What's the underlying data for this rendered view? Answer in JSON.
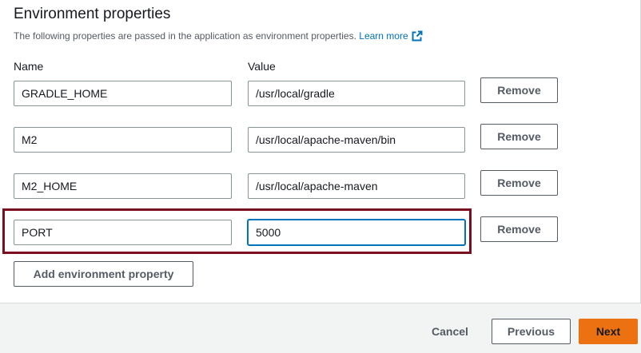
{
  "section": {
    "title": "Environment properties",
    "description": "The following properties are passed in the application as environment properties.",
    "learn_more": "Learn more",
    "name_label": "Name",
    "value_label": "Value"
  },
  "properties": [
    {
      "name": "GRADLE_HOME",
      "value": "/usr/local/gradle",
      "remove_label": "Remove"
    },
    {
      "name": "M2",
      "value": "/usr/local/apache-maven/bin",
      "remove_label": "Remove"
    },
    {
      "name": "M2_HOME",
      "value": "/usr/local/apache-maven",
      "remove_label": "Remove"
    },
    {
      "name": "PORT",
      "value": "5000",
      "remove_label": "Remove"
    }
  ],
  "add_button": "Add environment property",
  "footer": {
    "cancel": "Cancel",
    "previous": "Previous",
    "next": "Next"
  },
  "colors": {
    "primary": "#ec7211",
    "link": "#0073bb",
    "highlight_border": "#7b0e1f"
  }
}
